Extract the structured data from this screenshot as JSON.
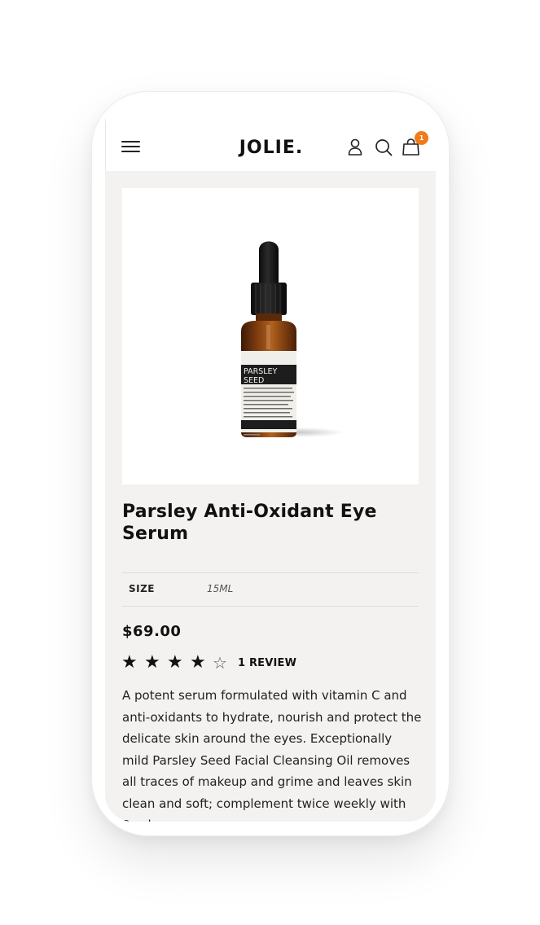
{
  "header": {
    "logo": "JOLIE.",
    "cart_count": "1",
    "icons": {
      "menu": "hamburger-menu-icon",
      "account": "user-icon",
      "search": "search-icon",
      "cart": "shopping-bag-icon"
    },
    "badge_color": "#f07b17"
  },
  "product": {
    "title": "Parsley Anti-Oxidant Eye Serum",
    "image_label_lines": [
      "PARSLEY",
      "SEED"
    ],
    "attributes": [
      {
        "label": "SIZE",
        "value": "15ML"
      }
    ],
    "price": "$69.00",
    "rating": 4,
    "rating_max": 5,
    "review_count_label": "1 REVIEW",
    "description": "A potent serum formulated with vitamin C and anti-oxidants to hydrate, nourish and protect the delicate skin around the eyes. Exceptionally mild Parsley Seed Facial Cleansing Oil removes all traces of makeup and grime and leaves skin clean and soft; complement twice weekly with Parsley"
  }
}
